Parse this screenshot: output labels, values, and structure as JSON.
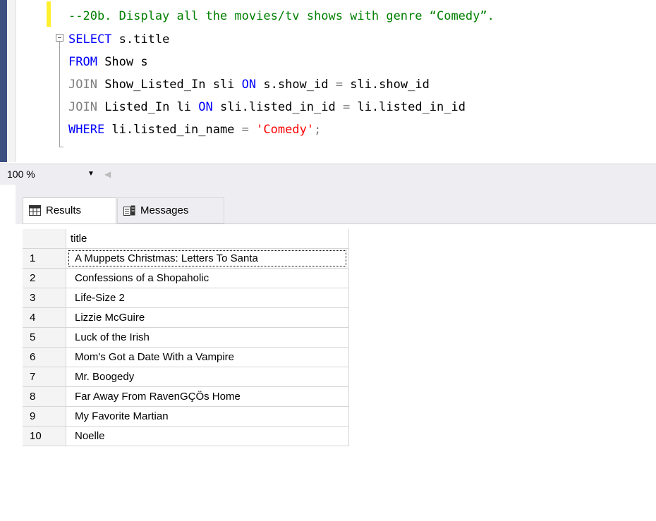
{
  "editor": {
    "lines": [
      {
        "comment": "--20b. Display all the movies/tv shows with genre “Comedy”."
      },
      {
        "kw1": "SELECT",
        "rest": " s.title"
      },
      {
        "kw1": "FROM",
        "rest": " Show s"
      },
      {
        "j": "JOIN",
        "mid": " Show_Listed_In sli ",
        "kw2": "ON",
        "a": " s.show_id ",
        "op": "=",
        "b": " sli.show_id"
      },
      {
        "j": "JOIN",
        "mid": " Listed_In li ",
        "kw2": "ON",
        "a": " sli.listed_in_id ",
        "op": "=",
        "b": " li.listed_in_id"
      },
      {
        "kw1": "WHERE",
        "a": " li.listed_in_name ",
        "op": "=",
        "space": " ",
        "str": "'Comedy'",
        "end": ";"
      }
    ]
  },
  "zoom": {
    "value": "100 %",
    "dropdown_icon": "chevron-down"
  },
  "tabs": {
    "results_label": "Results",
    "messages_label": "Messages"
  },
  "grid": {
    "column_header": "title",
    "rows": [
      {
        "num": "1",
        "title": "A Muppets Christmas: Letters To Santa"
      },
      {
        "num": "2",
        "title": "Confessions of a Shopaholic"
      },
      {
        "num": "3",
        "title": "Life-Size 2"
      },
      {
        "num": "4",
        "title": "Lizzie McGuire"
      },
      {
        "num": "5",
        "title": "Luck of the Irish"
      },
      {
        "num": "6",
        "title": "Mom's Got a Date With a Vampire"
      },
      {
        "num": "7",
        "title": "Mr. Boogedy"
      },
      {
        "num": "8",
        "title": "Far Away From RavenGÇÖs Home"
      },
      {
        "num": "9",
        "title": "My Favorite Martian"
      },
      {
        "num": "10",
        "title": "Noelle"
      }
    ]
  },
  "colors": {
    "keyword": "#0000ff",
    "comment": "#008000",
    "string": "#ff0000",
    "operator": "#808080"
  }
}
